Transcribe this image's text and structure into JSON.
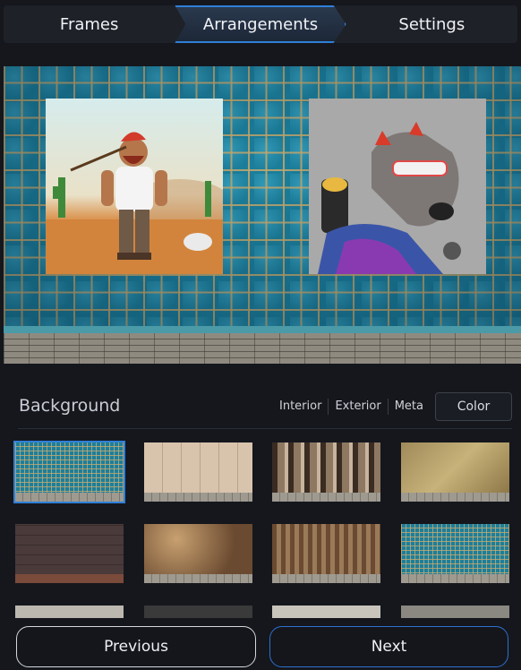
{
  "tabs": [
    {
      "label": "Frames",
      "active": false
    },
    {
      "label": "Arrangements",
      "active": true
    },
    {
      "label": "Settings",
      "active": false
    }
  ],
  "background": {
    "title": "Background",
    "filters": [
      "Interior",
      "Exterior",
      "Meta"
    ],
    "color_label": "Color",
    "thumbnails": [
      {
        "name": "teal-tiles",
        "selected": true
      },
      {
        "name": "light-wood-panels",
        "selected": false
      },
      {
        "name": "striped-wood",
        "selected": false
      },
      {
        "name": "gold-marble",
        "selected": false
      },
      {
        "name": "dark-brick-panel",
        "selected": false
      },
      {
        "name": "warm-spotlight-wood",
        "selected": false
      },
      {
        "name": "barn-wood",
        "selected": false
      },
      {
        "name": "teal-tiles-2",
        "selected": false
      }
    ]
  },
  "buttons": {
    "previous": "Previous",
    "next": "Next"
  },
  "colors": {
    "accent": "#2f7fd8",
    "bg": "#15171d"
  }
}
